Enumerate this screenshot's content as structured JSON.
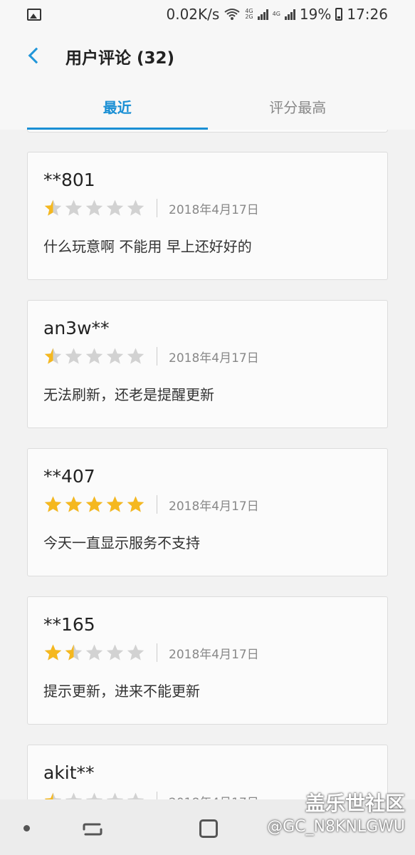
{
  "status_bar": {
    "speed": "0.02K/s",
    "net_top": "4G",
    "net_bottom": "2G",
    "net2": "4G",
    "battery": "19%",
    "time": "17:26"
  },
  "header": {
    "title": "用户评论 (32)"
  },
  "tabs": [
    {
      "label": "最近",
      "active": true
    },
    {
      "label": "评分最高",
      "active": false
    }
  ],
  "reviews": [
    {
      "user": "**801",
      "rating": 0.5,
      "date": "2018年4月17日",
      "text": "什么玩意啊  不能用  早上还好好的"
    },
    {
      "user": "an3w**",
      "rating": 0.5,
      "date": "2018年4月17日",
      "text": "无法刷新，还老是提醒更新"
    },
    {
      "user": "**407",
      "rating": 5,
      "date": "2018年4月17日",
      "text": "今天一直显示服务不支持"
    },
    {
      "user": "**165",
      "rating": 1.5,
      "date": "2018年4月17日",
      "text": "提示更新，进来不能更新"
    },
    {
      "user": "akit**",
      "rating": 0.5,
      "date": "2018年4月17日",
      "text": ""
    }
  ],
  "colors": {
    "accent": "#1a8fd4",
    "star_filled": "#f5b81f",
    "star_empty": "#d2d2d2"
  },
  "watermark": {
    "title": "盖乐世社区",
    "user": "@GC_N8KNLGWU"
  }
}
